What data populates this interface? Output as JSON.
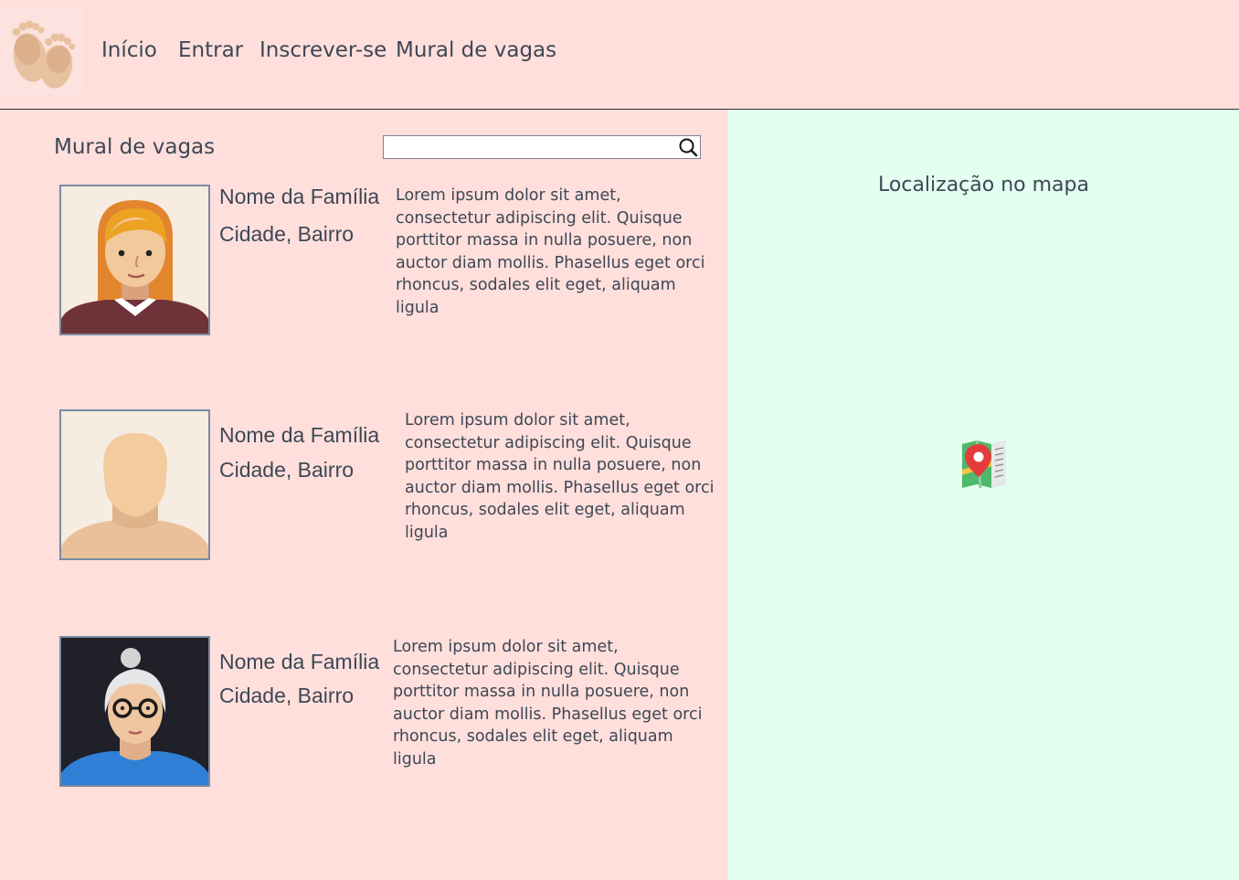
{
  "header": {
    "logo_icon": "baby-feet-icon",
    "nav": [
      {
        "label": "Início"
      },
      {
        "label": "Entrar"
      },
      {
        "label": "Inscrever-se"
      },
      {
        "label": "Mural de vagas"
      }
    ]
  },
  "board": {
    "title": "Mural de vagas",
    "search": {
      "value": "",
      "placeholder": "",
      "icon": "search-icon"
    },
    "listings": [
      {
        "avatar": "woman-red-hair-avatar",
        "family_name": "Nome da Família",
        "location": "Cidade, Bairro",
        "description": "Lorem ipsum dolor sit amet, consectetur adipiscing elit. Quisque porttitor massa in nulla posuere, non auctor diam mollis. Phasellus eget orci rhoncus, sodales elit eget, aliquam ligula"
      },
      {
        "avatar": "default-person-avatar",
        "family_name": "Nome da Família",
        "location": "Cidade, Bairro",
        "description": "Lorem ipsum dolor sit amet, consectetur adipiscing elit. Quisque porttitor massa in nulla posuere, non auctor diam mollis. Phasellus eget orci rhoncus, sodales elit eget, aliquam ligula"
      },
      {
        "avatar": "elderly-woman-glasses-avatar",
        "family_name": "Nome da Família",
        "location": "Cidade, Bairro",
        "description": "Lorem ipsum dolor sit amet, consectetur adipiscing elit. Quisque porttitor massa in nulla posuere, non auctor diam mollis. Phasellus eget orci rhoncus, sodales elit eget, aliquam ligula"
      }
    ]
  },
  "map": {
    "title": "Localização no mapa",
    "icon": "map-pin-icon"
  },
  "colors": {
    "page_bg": "#ffdfdb",
    "map_bg": "#e3fff0",
    "text": "#3d4756",
    "avatar_border": "#7a8aa3"
  }
}
